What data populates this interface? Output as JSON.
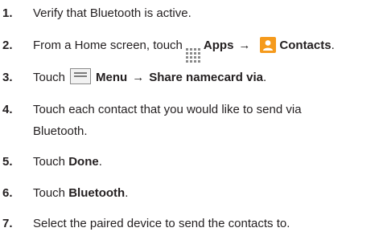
{
  "steps": [
    {
      "number": "1.",
      "text": "Verify that Bluetooth is active."
    },
    {
      "number": "2.",
      "pre": "From a Home screen, touch",
      "apps_label": "Apps",
      "arrow": "→",
      "contacts_label": "Contacts",
      "post": "."
    },
    {
      "number": "3.",
      "pre": "Touch",
      "menu_label": "Menu",
      "arrow": "→",
      "share_label": "Share namecard via",
      "post": "."
    },
    {
      "number": "4.",
      "line1": "Touch each contact that you would like to send via",
      "line2": "Bluetooth."
    },
    {
      "number": "5.",
      "pre": "Touch",
      "bold": "Done",
      "post": "."
    },
    {
      "number": "6.",
      "pre": "Touch",
      "bold": "Bluetooth",
      "post": "."
    },
    {
      "number": "7.",
      "text": "Select the paired device to send the contacts to."
    }
  ],
  "icons": {
    "apps": "apps-grid-icon",
    "contacts": "contacts-icon",
    "menu": "menu-icon"
  },
  "colors": {
    "text": "#231f20",
    "contacts_icon_bg": "#f59a1c",
    "icon_gray": "#8a8a8a"
  }
}
